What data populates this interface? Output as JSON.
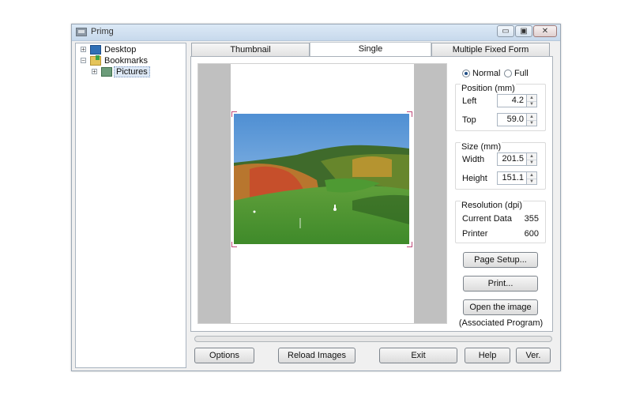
{
  "window": {
    "title": "Primg",
    "minimize_icon": "minimize-icon",
    "maximize_icon": "maximize-icon",
    "close_icon": "close-icon",
    "min_glyph": "▭",
    "max_glyph": "▣",
    "close_glyph": "✕"
  },
  "tree": {
    "items": [
      {
        "label": "Desktop",
        "expander": "+",
        "icon": "desktop-icon"
      },
      {
        "label": "Bookmarks",
        "expander": "−",
        "icon": "bookmarks-icon"
      },
      {
        "label": "Pictures",
        "expander": "+",
        "icon": "pictures-icon",
        "selected": true
      }
    ]
  },
  "tabs": [
    {
      "label": "Thumbnail"
    },
    {
      "label": "Single",
      "active": true
    },
    {
      "label": "Multiple Fixed Form"
    }
  ],
  "mode": {
    "normal_label": "Normal",
    "full_label": "Full",
    "selected": "Normal"
  },
  "position": {
    "title": "Position (mm)",
    "left_label": "Left",
    "left_value": "4.2",
    "top_label": "Top",
    "top_value": "59.0"
  },
  "size": {
    "title": "Size (mm)",
    "width_label": "Width",
    "width_value": "201.5",
    "height_label": "Height",
    "height_value": "151.1"
  },
  "resolution": {
    "title": "Resolution (dpi)",
    "current_label": "Current Data",
    "current_value": "355",
    "printer_label": "Printer",
    "printer_value": "600"
  },
  "buttons": {
    "page_setup": "Page Setup...",
    "print": "Print...",
    "open_image": "Open the image",
    "open_image_caption": "(Associated Program)"
  },
  "bottom": {
    "options": "Options",
    "reload": "Reload Images",
    "exit": "Exit",
    "help": "Help",
    "ver": "Ver."
  },
  "spin_glyphs": {
    "up": "▲",
    "down": "▼"
  },
  "colors": {
    "accent": "#1f4e86",
    "margin_gray": "#c0c0c0",
    "crop_marks": "#c04a7a"
  }
}
